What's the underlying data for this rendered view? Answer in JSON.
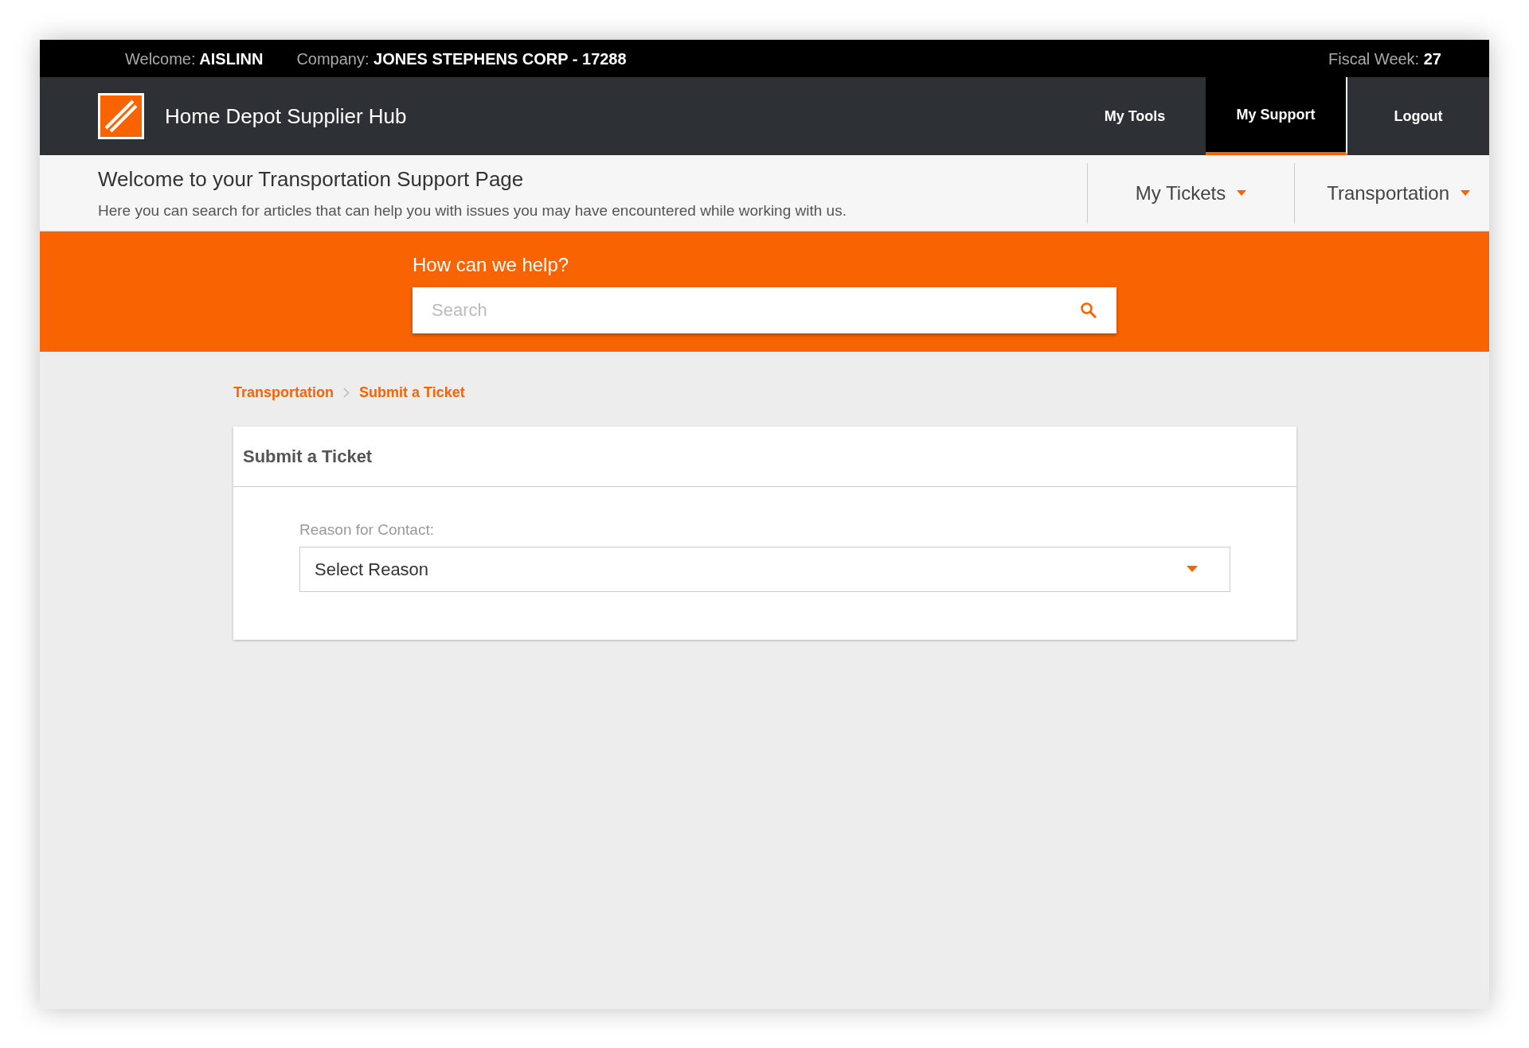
{
  "top_bar": [
    {
      "label": "Welcome:",
      "value": "AISLINN"
    },
    {
      "label": "Company:",
      "value": "JONES STEPHENS CORP - 17288"
    },
    {
      "label": "Fiscal Week:",
      "value": "27"
    }
  ],
  "header": {
    "title": "Home Depot Supplier Hub",
    "nav": [
      {
        "label": "My Tools",
        "selected": false
      },
      {
        "label": "My Support",
        "selected": true
      },
      {
        "label": "Logout",
        "selected": false
      }
    ]
  },
  "subheader": {
    "title": "Welcome to your Transportation Support Page",
    "subtitle": "Here you can search for articles that can help you with issues you may have encountered while working with us.",
    "menus": [
      "My Tickets",
      "Transportation"
    ]
  },
  "search": {
    "heading": "How can we help?",
    "placeholder": "Search"
  },
  "breadcrumb": [
    "Transportation",
    "Submit a Ticket"
  ],
  "card": {
    "title": "Submit a Ticket",
    "field_label": "Reason for Contact:",
    "select_value": "Select Reason"
  }
}
